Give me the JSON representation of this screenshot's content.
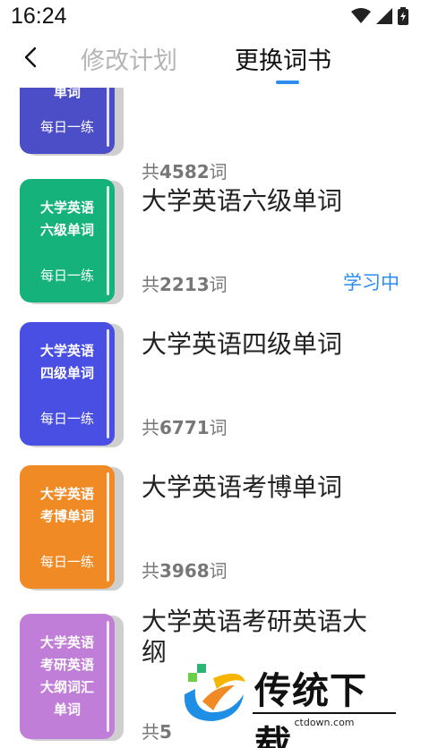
{
  "status": {
    "time": "16:24"
  },
  "nav": {
    "tabs": [
      {
        "label": "修改计划",
        "active": false
      },
      {
        "label": "更换词书",
        "active": true
      }
    ],
    "indicator_color": "#2d8cf0"
  },
  "books": [
    {
      "cover_title": "专业四级\n单词",
      "cover_sub": "每日一练",
      "cover_color": "#4b4ec6",
      "name": "",
      "count_prefix": "共",
      "count": "4582",
      "count_suffix": "词",
      "badge": ""
    },
    {
      "cover_title": "大学英语\n六级单词",
      "cover_sub": "每日一练",
      "cover_color": "#15b27c",
      "name": "大学英语六级单词",
      "count_prefix": "共",
      "count": "2213",
      "count_suffix": "词",
      "badge": "学习中"
    },
    {
      "cover_title": "大学英语\n四级单词",
      "cover_sub": "每日一练",
      "cover_color": "#4a4fe3",
      "name": "大学英语四级单词",
      "count_prefix": "共",
      "count": "6771",
      "count_suffix": "词",
      "badge": ""
    },
    {
      "cover_title": "大学英语\n考博单词",
      "cover_sub": "每日一练",
      "cover_color": "#f08a25",
      "name": "大学英语考博单词",
      "count_prefix": "共",
      "count": "3968",
      "count_suffix": "词",
      "badge": ""
    },
    {
      "cover_title": "大学英语\n考研英语\n大纲词汇\n单词",
      "cover_sub": "",
      "cover_color": "#c07ed8",
      "name": "大学英语考研英语大纲",
      "count_prefix": "共",
      "count": "5",
      "count_suffix": "",
      "badge": ""
    }
  ],
  "watermark": {
    "text": "传统下载",
    "url": "ctdown.com"
  }
}
